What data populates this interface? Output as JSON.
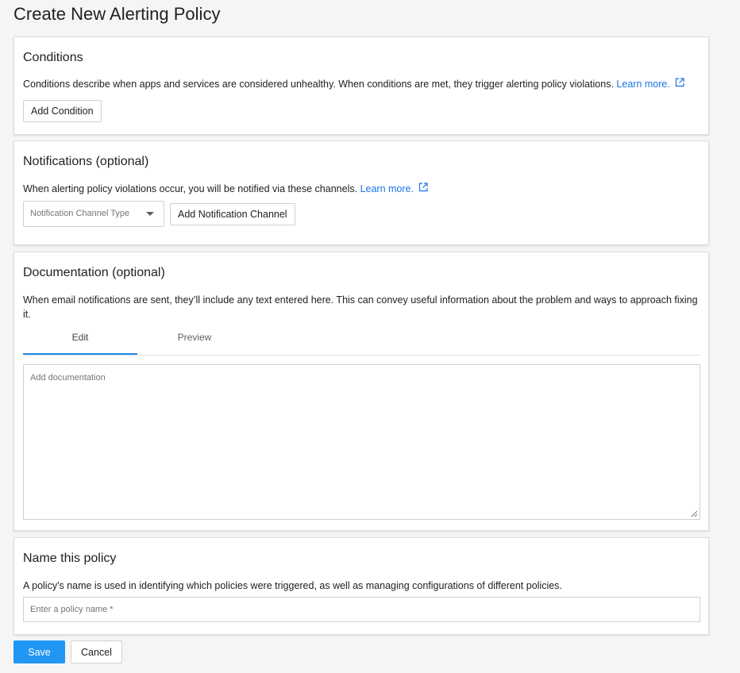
{
  "page": {
    "title": "Create New Alerting Policy"
  },
  "conditions": {
    "title": "Conditions",
    "description": "Conditions describe when apps and services are considered unhealthy. When conditions are met, they trigger alerting policy violations.",
    "learn_more": "Learn more.",
    "add_button": "Add Condition"
  },
  "notifications": {
    "title": "Notifications (optional)",
    "description": "When alerting policy violations occur, you will be notified via these channels.",
    "learn_more": "Learn more.",
    "channel_type_placeholder": "Notification Channel Type",
    "add_button": "Add Notification Channel"
  },
  "documentation": {
    "title": "Documentation (optional)",
    "description": "When email notifications are sent, they’ll include any text entered here. This can convey useful information about the problem and ways to approach fixing it.",
    "tabs": [
      {
        "label": "Edit",
        "active": true
      },
      {
        "label": "Preview",
        "active": false
      }
    ],
    "placeholder": "Add documentation"
  },
  "name_policy": {
    "title": "Name this policy",
    "description": "A policy's name is used in identifying which policies were triggered, as well as managing configurations of different policies.",
    "placeholder": "Enter a policy name  *"
  },
  "actions": {
    "save_label": "Save",
    "cancel_label": "Cancel"
  },
  "colors": {
    "accent": "#1e88e5",
    "link": "#1a73e8",
    "save_button": "#2196f3"
  },
  "icons": {
    "external_link": "external-link-icon",
    "dropdown": "chevron-down-icon",
    "resize": "resize-grip-icon"
  }
}
